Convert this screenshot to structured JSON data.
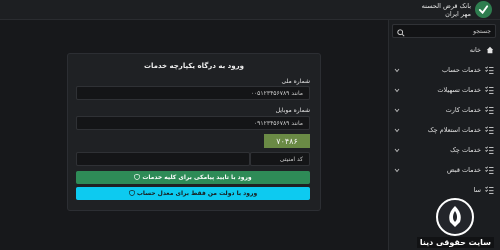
{
  "header": {
    "brand_line1": "بانک قرض الحسنه",
    "brand_line2": "مهر ایران"
  },
  "sidebar": {
    "search_placeholder": "جستجو",
    "items": [
      {
        "label": "خانه",
        "icon": "home-icon"
      },
      {
        "label": "خدمات حساب",
        "icon": "checklist-icon"
      },
      {
        "label": "خدمات تسهیلات",
        "icon": "checklist-icon"
      },
      {
        "label": "خدمات کارت",
        "icon": "checklist-icon"
      },
      {
        "label": "خدمات استعلام چک",
        "icon": "checklist-icon"
      },
      {
        "label": "خدمات چک",
        "icon": "checklist-icon"
      },
      {
        "label": "خدمات قبض",
        "icon": "checklist-icon"
      },
      {
        "label": "سا",
        "icon": "checklist-icon"
      }
    ]
  },
  "login": {
    "title": "ورود به درگاه یکپارچه خدمات",
    "national_id_label": "شماره ملی",
    "national_id_placeholder": "مانند ۰۰۵۱۲۳۴۵۶۷۸۹",
    "mobile_label": "شماره موبایل",
    "mobile_placeholder": "مانند ۰۹۱۲۳۴۵۶۷۸۹",
    "captcha_text": "۷۰۴۸۶",
    "captcha_placeholder": "کد امنیتی",
    "primary_button": "ورود با تایید پیامکی برای کلیه خدمات",
    "secondary_button": "ورود با دولت من فقط برای معدل حساب"
  },
  "watermark": {
    "text": "سایت حقوقی دینا"
  },
  "colors": {
    "background": "#17181b",
    "card": "#1f2124",
    "primary": "#2e8b57",
    "secondary": "#0dcaf0",
    "captcha": "#6a8a45"
  }
}
